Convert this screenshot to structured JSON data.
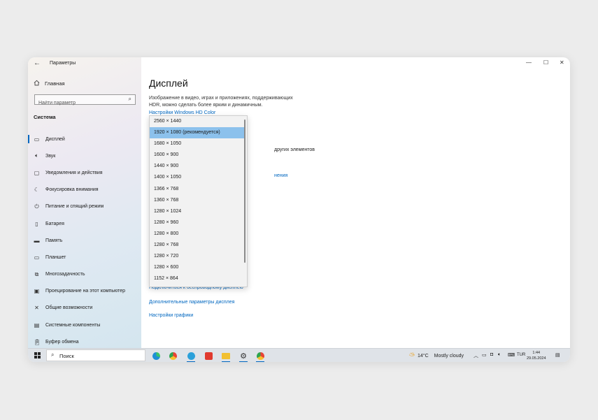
{
  "window": {
    "title": "Параметры",
    "back_icon": "←",
    "controls": {
      "minimize": "—",
      "maximize": "☐",
      "close": "✕"
    }
  },
  "sidebar": {
    "home_label": "Главная",
    "search_placeholder": "Найти параметр",
    "section_title": "Система",
    "items": [
      {
        "label": "Дисплей",
        "icon": "display-icon",
        "active": true
      },
      {
        "label": "Звук",
        "icon": "sound-icon"
      },
      {
        "label": "Уведомления и действия",
        "icon": "notifications-icon"
      },
      {
        "label": "Фокусировка внимания",
        "icon": "focus-assist-icon"
      },
      {
        "label": "Питание и спящий режим",
        "icon": "power-icon"
      },
      {
        "label": "Батарея",
        "icon": "battery-icon"
      },
      {
        "label": "Память",
        "icon": "storage-icon"
      },
      {
        "label": "Планшет",
        "icon": "tablet-icon"
      },
      {
        "label": "Многозадачность",
        "icon": "multitasking-icon"
      },
      {
        "label": "Проецирование на этот компьютер",
        "icon": "projecting-icon"
      },
      {
        "label": "Общие возможности",
        "icon": "shared-experiences-icon"
      },
      {
        "label": "Системные компоненты",
        "icon": "system-components-icon"
      },
      {
        "label": "Буфер обмена",
        "icon": "clipboard-icon"
      }
    ]
  },
  "main": {
    "title": "Дисплей",
    "description": "Изображение в видео, играх и приложениях, поддерживающих HDR, можно сделать более ярким и динамичным.",
    "hdr_link": "Настройки Windows HD Color",
    "partial_text_1": "других элементов",
    "partial_link_1": "нения",
    "wireless_link": "Подключиться к беспроводному дисплею",
    "advanced_link": "Дополнительные параметры дисплея",
    "graphics_link": "Настройки графики"
  },
  "resolution_dropdown": {
    "selected": "1920 × 1080 (рекомендуется)",
    "options": [
      "2560 × 1440",
      "1920 × 1080 (рекомендуется)",
      "1680 × 1050",
      "1600 × 900",
      "1440 × 900",
      "1400 × 1050",
      "1366 × 768",
      "1360 × 768",
      "1280 × 1024",
      "1280 × 960",
      "1280 × 800",
      "1280 × 768",
      "1280 × 720",
      "1280 × 600",
      "1152 × 864"
    ]
  },
  "taskbar": {
    "search_label": "Поиск",
    "apps": [
      {
        "name": "edge-icon",
        "color": "#1e8fd6"
      },
      {
        "name": "chrome-icon",
        "color": "#e84335"
      },
      {
        "name": "telegram-icon",
        "color": "#2aa0da"
      },
      {
        "name": "anydesk-icon",
        "color": "#e03a2f"
      },
      {
        "name": "file-explorer-icon",
        "color": "#f2c031"
      },
      {
        "name": "settings-icon",
        "color": "#333333"
      },
      {
        "name": "chrome-icon",
        "color": "#e84335"
      }
    ],
    "weather": {
      "temp": "14°C",
      "condition": "Mostly cloudy"
    },
    "language": "TUR",
    "time": "1:44",
    "date": "29.05.2024"
  }
}
